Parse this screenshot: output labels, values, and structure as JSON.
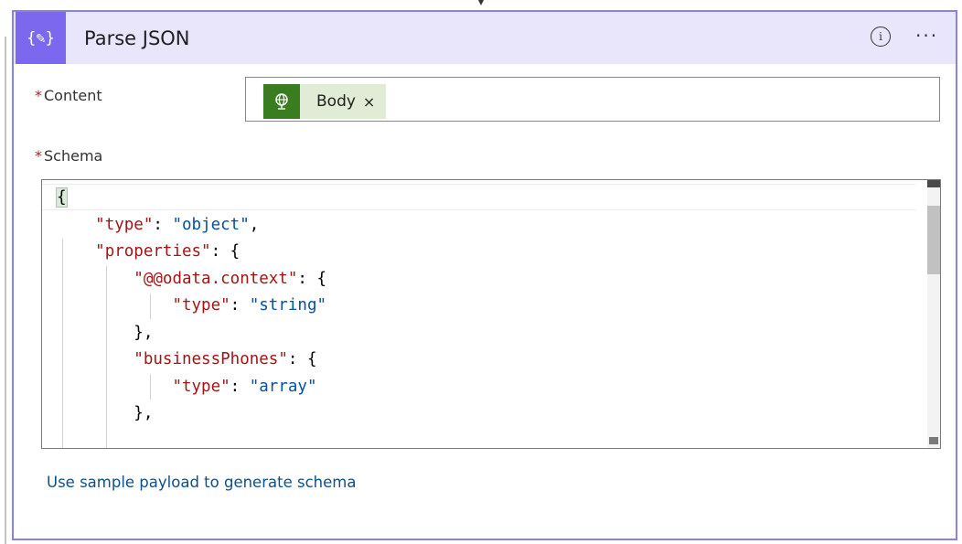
{
  "action": {
    "icon": "parse-json-icon",
    "icon_glyph": "{✎}",
    "title": "Parse JSON",
    "info_glyph": "i",
    "more_glyph": "···",
    "accent_color": "#7b68ee",
    "header_bg": "#e9e5fb",
    "border_color": "#8b7fe8"
  },
  "content_field": {
    "label": "Content",
    "required_marker": "*",
    "token": {
      "label": "Body",
      "remove_glyph": "×",
      "icon": "globe-icon",
      "color": "#3a7d21"
    }
  },
  "schema_field": {
    "label": "Schema",
    "required_marker": "*",
    "code_lines": [
      [
        {
          "t": "p",
          "v": "{"
        }
      ],
      [
        {
          "t": "p",
          "v": "    "
        },
        {
          "t": "k",
          "v": "\"type\""
        },
        {
          "t": "p",
          "v": ": "
        },
        {
          "t": "s",
          "v": "\"object\""
        },
        {
          "t": "p",
          "v": ","
        }
      ],
      [
        {
          "t": "p",
          "v": "    "
        },
        {
          "t": "k",
          "v": "\"properties\""
        },
        {
          "t": "p",
          "v": ": {"
        }
      ],
      [
        {
          "t": "p",
          "v": "        "
        },
        {
          "t": "k",
          "v": "\"@@odata.context\""
        },
        {
          "t": "p",
          "v": ": {"
        }
      ],
      [
        {
          "t": "p",
          "v": "            "
        },
        {
          "t": "k",
          "v": "\"type\""
        },
        {
          "t": "p",
          "v": ": "
        },
        {
          "t": "s",
          "v": "\"string\""
        }
      ],
      [
        {
          "t": "p",
          "v": "        },"
        }
      ],
      [
        {
          "t": "p",
          "v": "        "
        },
        {
          "t": "k",
          "v": "\"businessPhones\""
        },
        {
          "t": "p",
          "v": ": {"
        }
      ],
      [
        {
          "t": "p",
          "v": "            "
        },
        {
          "t": "k",
          "v": "\"type\""
        },
        {
          "t": "p",
          "v": ": "
        },
        {
          "t": "s",
          "v": "\"array\""
        }
      ],
      [
        {
          "t": "p",
          "v": "        },"
        }
      ],
      [
        {
          "t": "p",
          "v": "        "
        }
      ]
    ]
  },
  "sample_link": {
    "label": "Use sample payload to generate schema"
  }
}
